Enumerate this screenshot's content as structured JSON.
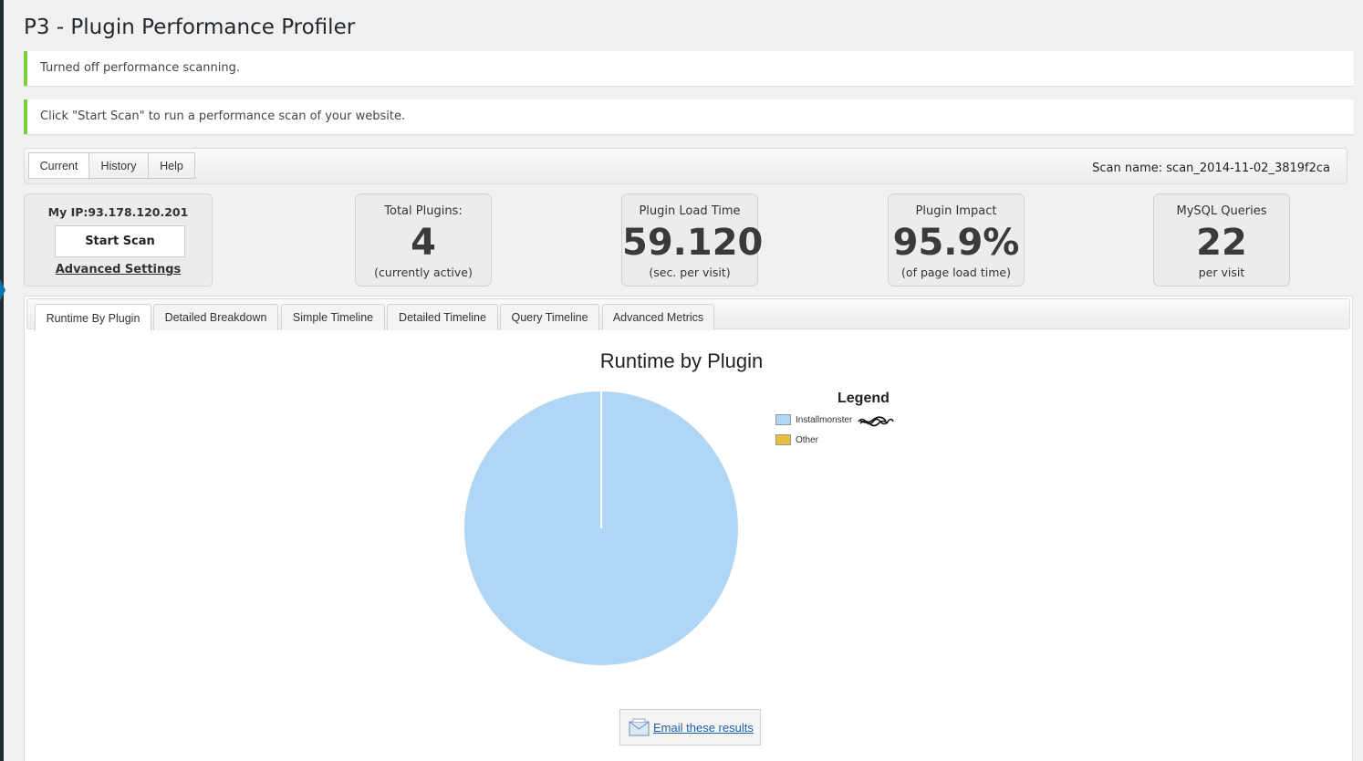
{
  "page": {
    "title": "P3 - Plugin Performance Profiler"
  },
  "notices": [
    "Turned off performance scanning.",
    "Click \"Start Scan\" to run a performance scan of your website."
  ],
  "toolbar": {
    "buttons": [
      "Current",
      "History",
      "Help"
    ],
    "scan_name": "Scan name: scan_2014-11-02_3819f2ca"
  },
  "ip_box": {
    "ip_label": "My IP:93.178.120.201",
    "start_scan": "Start Scan",
    "advanced_settings": "Advanced Settings"
  },
  "stats": [
    {
      "label": "Total Plugins:",
      "value": "4",
      "sub": "(currently active)"
    },
    {
      "label": "Plugin Load Time",
      "value": "59.120",
      "sub": "(sec. per visit)"
    },
    {
      "label": "Plugin Impact",
      "value": "95.9%",
      "sub": "(of page load time)"
    },
    {
      "label": "MySQL Queries",
      "value": "22",
      "sub": "per visit"
    }
  ],
  "tabs": [
    "Runtime By Plugin",
    "Detailed Breakdown",
    "Simple Timeline",
    "Detailed Timeline",
    "Query Timeline",
    "Advanced Metrics"
  ],
  "chart_data": {
    "type": "pie",
    "title": "Runtime by Plugin",
    "legend_title": "Legend",
    "legend": "right",
    "slices": [
      {
        "name": "Installmonster",
        "value": 100,
        "color": "#b0d6f5"
      },
      {
        "name": "Other",
        "value": 0,
        "color": "#e8be3b"
      }
    ]
  },
  "email": {
    "label": "Email these results",
    "icon": "envelope-icon"
  }
}
